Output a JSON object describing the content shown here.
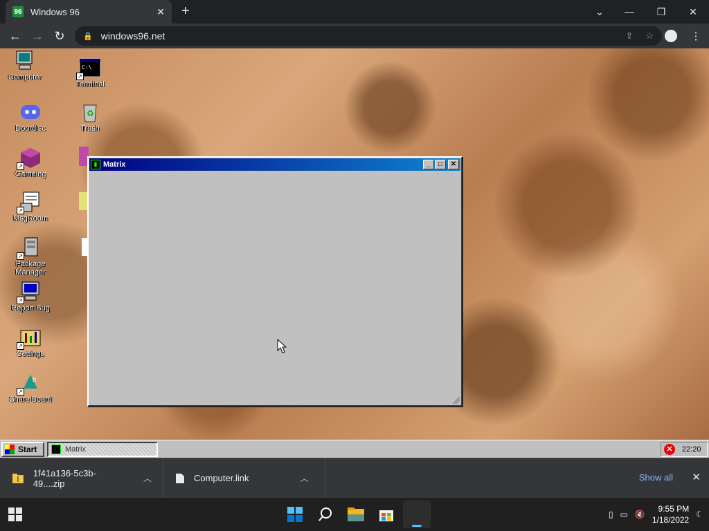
{
  "browser": {
    "tab_title": "Windows 96",
    "url": "windows96.net"
  },
  "desktop": {
    "icons_col1": [
      "Computer",
      "Doordisc",
      "Gameing",
      "MsgRoom",
      "Package Manager",
      "Report Bug",
      "Settings",
      "Share Board"
    ],
    "icons_col2": [
      "Terminal",
      "Trash"
    ]
  },
  "matrix_window": {
    "title": "Matrix"
  },
  "win96_taskbar": {
    "start_label": "Start",
    "task_item": "Matrix",
    "tray_time": "22:20"
  },
  "downloads": {
    "items": [
      "1f41a136-5c3b-49....zip",
      "Computer.link"
    ],
    "show_all": "Show all"
  },
  "win11_taskbar": {
    "time": "9:55 PM",
    "date": "1/18/2022"
  }
}
